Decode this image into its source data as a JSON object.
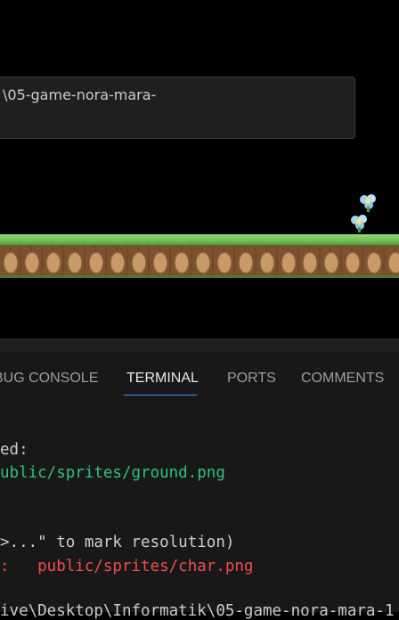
{
  "notification": {
    "text": "\\05-game-nora-mara-"
  },
  "panel": {
    "tabs": [
      {
        "label": "BUG CONSOLE",
        "active": false
      },
      {
        "label": "TERMINAL",
        "active": true
      },
      {
        "label": "PORTS",
        "active": false
      },
      {
        "label": "COMMENTS",
        "active": false
      }
    ],
    "accent_color": "#3794ff"
  },
  "terminal": {
    "lines": [
      {
        "text": "ed:",
        "color": "#cccccc"
      },
      {
        "text": "ublic/sprites/ground.png",
        "color": "#2fc17f"
      },
      {
        "text": ">...\" to mark resolution)",
        "color": "#cccccc"
      },
      {
        "text": ":   public/sprites/char.png",
        "color": "#f14c4c"
      },
      {
        "text": "ive\\Desktop\\Informatik\\05-game-nora-mara-1",
        "color": "#cccccc"
      }
    ]
  },
  "game": {
    "ground_sprite": "grass-dirt-tile",
    "characters": [
      "flower-sprite",
      "flower-sprite"
    ]
  }
}
